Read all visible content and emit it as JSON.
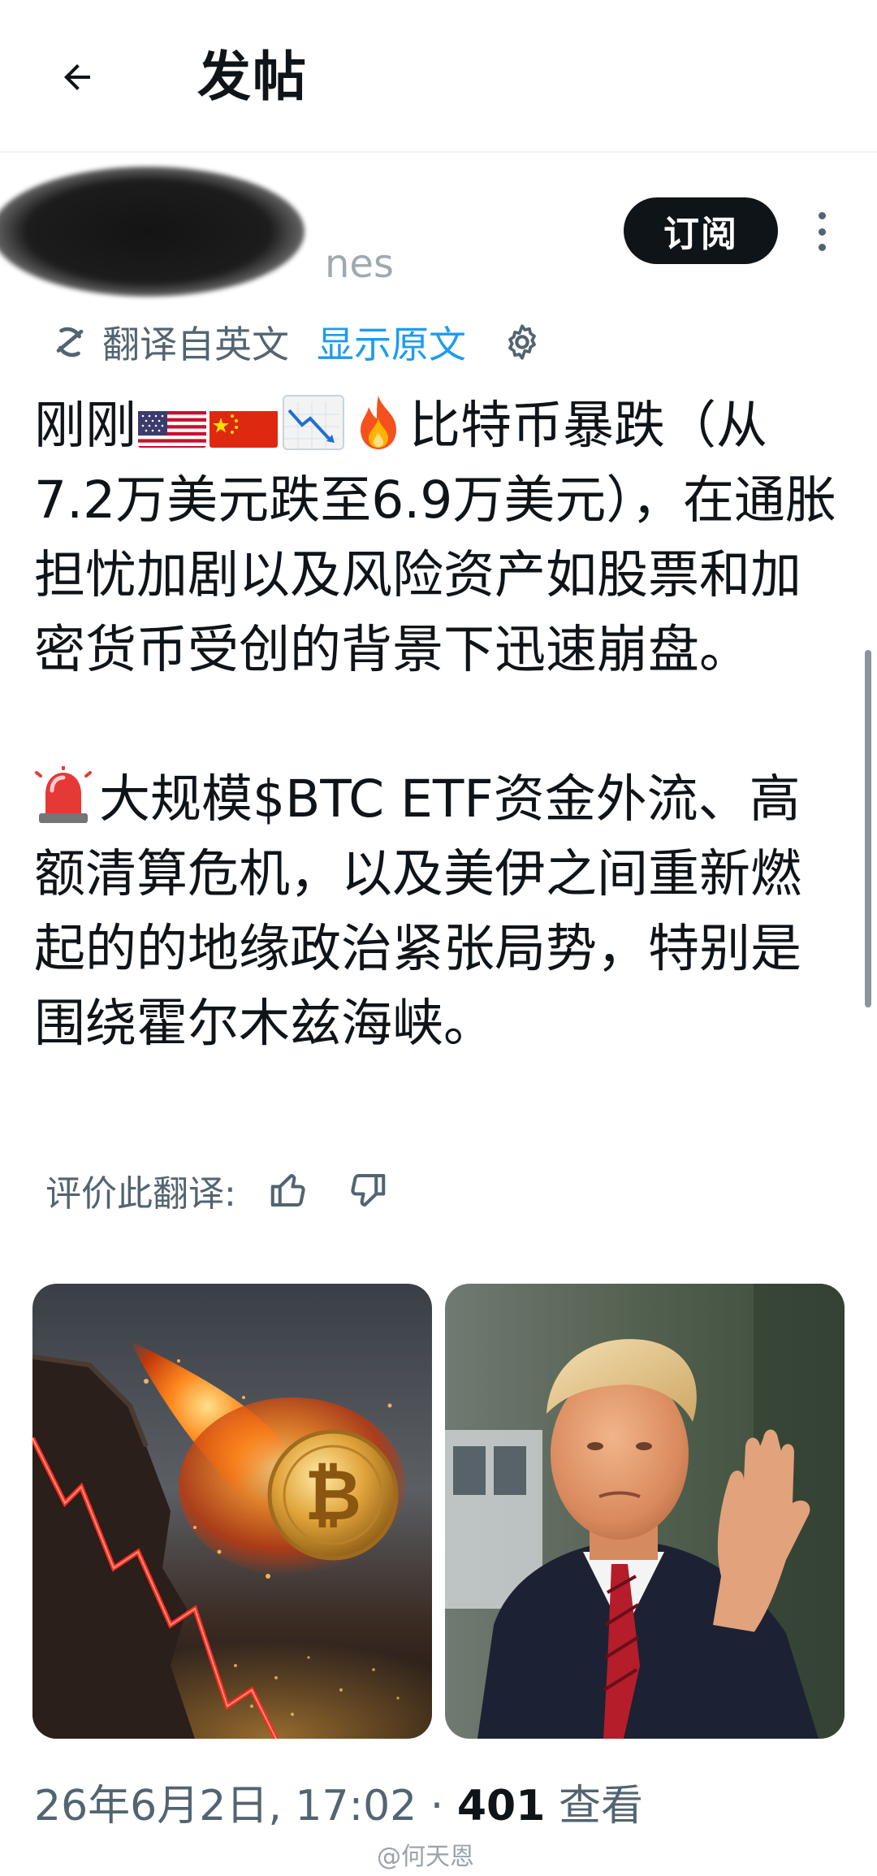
{
  "header": {
    "title": "发帖"
  },
  "author": {
    "handle_fragment": "nes"
  },
  "subscribe_label": "订阅",
  "translation": {
    "translated_from": "翻译自英文",
    "show_original": "显示原文"
  },
  "post": {
    "seg1": "刚刚",
    "seg2": "比特币暴跌（从7.2万美元跌至6.9万美元），在通胀担忧加剧以及风险资产如股票和加密货币受创的背景下迅速崩盘。\n\n",
    "seg3": "大规模$BTC ETF资金外流、高额清算危机，以及美伊之间重新燃起的的地缘政治紧张局势，特别是围绕霍尔木兹海峡。",
    "emojis": [
      "us-flag",
      "china-flag",
      "chart-decreasing",
      "fire",
      "police-light"
    ]
  },
  "rate": {
    "label": "评价此翻译:"
  },
  "media": [
    {
      "name": "bitcoin-meteor-image"
    },
    {
      "name": "politician-photo"
    }
  ],
  "meta": {
    "timestamp": "26年6月2日, 17:02",
    "separator": " · ",
    "views_count": "401",
    "views_label": "查看"
  },
  "watermark": "@何天恩",
  "colors": {
    "accent": "#1d9bf0",
    "text": "#0f1419",
    "muted": "#536471"
  }
}
